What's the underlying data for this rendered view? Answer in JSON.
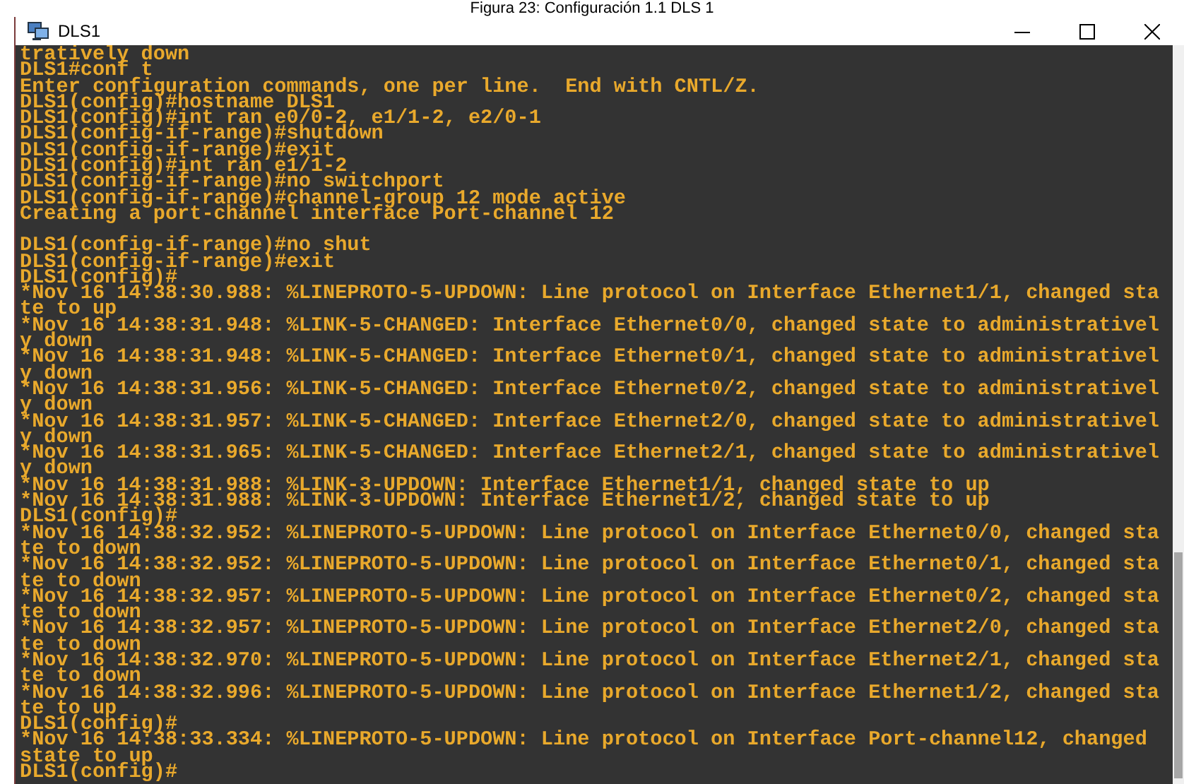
{
  "caption": "Figura 23: Configuración 1.1 DLS 1",
  "window": {
    "title": "DLS1"
  },
  "terminal": {
    "blocks": [
      [
        "tratively down",
        "DLS1#conf t",
        "Enter configuration commands, one per line.  End with CNTL/Z.",
        "DLS1(config)#hostname DLS1",
        "DLS1(config)#int ran e0/0-2, e1/1-2, e2/0-1",
        "DLS1(config-if-range)#shutdown",
        "DLS1(config-if-range)#exit",
        "DLS1(config)#int ran e1/1-2",
        "DLS1(config-if-range)#no switchport",
        "DLS1(config-if-range)#channel-group 12 mode active",
        "Creating a port-channel interface Port-channel 12"
      ],
      [
        "DLS1(config-if-range)#no shut",
        "DLS1(config-if-range)#exit",
        "DLS1(config)#",
        "*Nov 16 14:38:30.988: %LINEPROTO-5-UPDOWN: Line protocol on Interface Ethernet1/1, changed sta",
        "te to up",
        "*Nov 16 14:38:31.948: %LINK-5-CHANGED: Interface Ethernet0/0, changed state to administrativel",
        "y down",
        "*Nov 16 14:38:31.948: %LINK-5-CHANGED: Interface Ethernet0/1, changed state to administrativel",
        "y down",
        "*Nov 16 14:38:31.956: %LINK-5-CHANGED: Interface Ethernet0/2, changed state to administrativel",
        "y down",
        "*Nov 16 14:38:31.957: %LINK-5-CHANGED: Interface Ethernet2/0, changed state to administrativel",
        "y down",
        "*Nov 16 14:38:31.965: %LINK-5-CHANGED: Interface Ethernet2/1, changed state to administrativel",
        "y down",
        "*Nov 16 14:38:31.988: %LINK-3-UPDOWN: Interface Ethernet1/1, changed state to up",
        "*Nov 16 14:38:31.988: %LINK-3-UPDOWN: Interface Ethernet1/2, changed state to up",
        "DLS1(config)#",
        "*Nov 16 14:38:32.952: %LINEPROTO-5-UPDOWN: Line protocol on Interface Ethernet0/0, changed sta",
        "te to down",
        "*Nov 16 14:38:32.952: %LINEPROTO-5-UPDOWN: Line protocol on Interface Ethernet0/1, changed sta",
        "te to down",
        "*Nov 16 14:38:32.957: %LINEPROTO-5-UPDOWN: Line protocol on Interface Ethernet0/2, changed sta",
        "te to down",
        "*Nov 16 14:38:32.957: %LINEPROTO-5-UPDOWN: Line protocol on Interface Ethernet2/0, changed sta",
        "te to down",
        "*Nov 16 14:38:32.970: %LINEPROTO-5-UPDOWN: Line protocol on Interface Ethernet2/1, changed sta",
        "te to down",
        "*Nov 16 14:38:32.996: %LINEPROTO-5-UPDOWN: Line protocol on Interface Ethernet1/2, changed sta",
        "te to up",
        "DLS1(config)#",
        "*Nov 16 14:38:33.334: %LINEPROTO-5-UPDOWN: Line protocol on Interface Port-channel12, changed",
        "state to up",
        "DLS1(config)#"
      ]
    ]
  }
}
